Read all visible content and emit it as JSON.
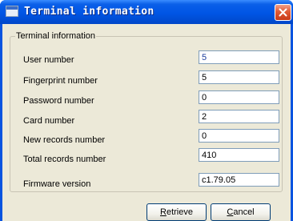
{
  "window": {
    "title": "Terminal information",
    "icon": "window-app-icon",
    "close_icon": "close-icon"
  },
  "group": {
    "title": "Terminal information"
  },
  "fields": [
    {
      "label": "User number",
      "value": "5"
    },
    {
      "label": "Fingerprint number",
      "value": "5"
    },
    {
      "label": "Password number",
      "value": "0"
    },
    {
      "label": "Card number",
      "value": "2"
    },
    {
      "label": "New records number",
      "value": "0"
    },
    {
      "label": "Total records number",
      "value": "410"
    },
    {
      "label": "Firmware version",
      "value": "c1.79.05"
    }
  ],
  "buttons": {
    "retrieve": {
      "mnemonic": "R",
      "rest": "etrieve"
    },
    "cancel": {
      "mnemonic": "C",
      "rest": "ancel"
    }
  },
  "colors": {
    "titlebar": "#0055e5",
    "client": "#ece9d8",
    "close_button": "#e05a35"
  }
}
